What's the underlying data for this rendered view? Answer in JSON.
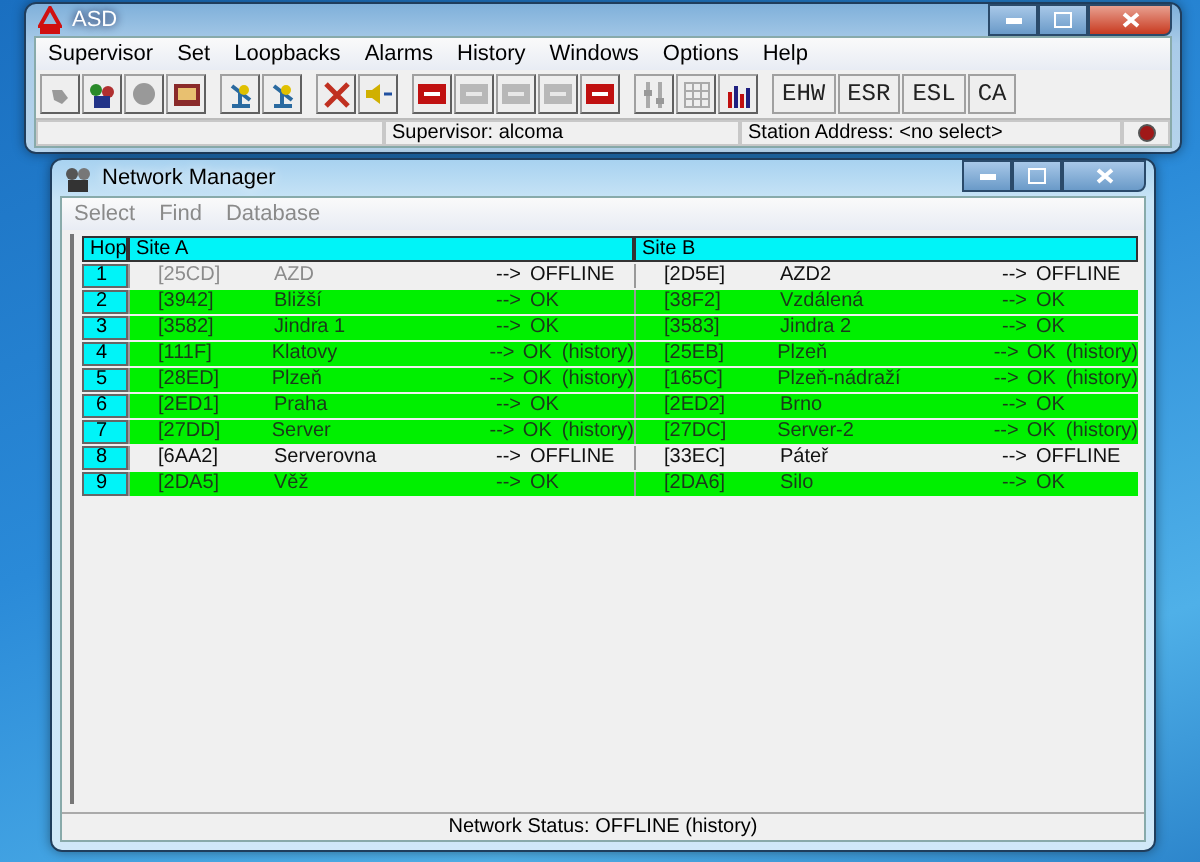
{
  "app_window": {
    "title": "ASD",
    "menu": [
      "Supervisor",
      "Set",
      "Loopbacks",
      "Alarms",
      "History",
      "Windows",
      "Options",
      "Help"
    ],
    "text_buttons": [
      "EHW",
      "ESR",
      "ESL",
      "CA"
    ],
    "status_bar": {
      "supervisor": "Supervisor: alcoma",
      "station_address": "Station Address: <no select>"
    }
  },
  "network_manager": {
    "title": "Network Manager",
    "menu": [
      {
        "label": "Select",
        "disabled": true
      },
      {
        "label": "Find",
        "disabled": true
      },
      {
        "label": "Database",
        "disabled": true
      }
    ],
    "columns": [
      "Hop",
      "Site A",
      "Site B"
    ],
    "rows": [
      {
        "hop": "1",
        "site_a": {
          "id": "[25CD]",
          "name": "AZD",
          "arrow": "-->",
          "status": "OFFLINE",
          "online": false,
          "faded": true
        },
        "site_b": {
          "id": "[2D5E]",
          "name": "AZD2",
          "arrow": "-->",
          "status": "OFFLINE",
          "online": false,
          "faded": false
        }
      },
      {
        "hop": "2",
        "site_a": {
          "id": "[3942]",
          "name": "Bližší",
          "arrow": "-->",
          "status": "OK",
          "online": true,
          "faded": false
        },
        "site_b": {
          "id": "[38F2]",
          "name": "Vzdálená",
          "arrow": "-->",
          "status": "OK",
          "online": true,
          "faded": false
        }
      },
      {
        "hop": "3",
        "site_a": {
          "id": "[3582]",
          "name": "Jindra 1",
          "arrow": "-->",
          "status": "OK",
          "online": true,
          "faded": false
        },
        "site_b": {
          "id": "[3583]",
          "name": "Jindra 2",
          "arrow": "-->",
          "status": "OK",
          "online": true,
          "faded": false
        }
      },
      {
        "hop": "4",
        "site_a": {
          "id": "[111F]",
          "name": "Klatovy",
          "arrow": "-->",
          "status": "OK",
          "note": "(history)",
          "online": true,
          "faded": false
        },
        "site_b": {
          "id": "[25EB]",
          "name": "Plzeň",
          "arrow": "-->",
          "status": "OK",
          "note": "(history)",
          "online": true,
          "faded": false
        }
      },
      {
        "hop": "5",
        "site_a": {
          "id": "[28ED]",
          "name": "Plzeň",
          "arrow": "-->",
          "status": "OK",
          "note": "(history)",
          "online": true,
          "faded": false
        },
        "site_b": {
          "id": "[165C]",
          "name": "Plzeň-nádraží",
          "arrow": "-->",
          "status": "OK",
          "note": "(history)",
          "online": true,
          "faded": false
        }
      },
      {
        "hop": "6",
        "site_a": {
          "id": "[2ED1]",
          "name": "Praha",
          "arrow": "-->",
          "status": "OK",
          "online": true,
          "faded": false
        },
        "site_b": {
          "id": "[2ED2]",
          "name": "Brno",
          "arrow": "-->",
          "status": "OK",
          "online": true,
          "faded": false
        }
      },
      {
        "hop": "7",
        "site_a": {
          "id": "[27DD]",
          "name": "Server",
          "arrow": "-->",
          "status": "OK",
          "note": "(history)",
          "online": true,
          "faded": false
        },
        "site_b": {
          "id": "[27DC]",
          "name": "Server-2",
          "arrow": "-->",
          "status": "OK",
          "note": "(history)",
          "online": true,
          "faded": false
        }
      },
      {
        "hop": "8",
        "site_a": {
          "id": "[6AA2]",
          "name": "Serverovna",
          "arrow": "-->",
          "status": "OFFLINE",
          "online": false,
          "faded": false
        },
        "site_b": {
          "id": "[33EC]",
          "name": "Páteř",
          "arrow": "-->",
          "status": "OFFLINE",
          "online": false,
          "faded": false
        }
      },
      {
        "hop": "9",
        "site_a": {
          "id": "[2DA5]",
          "name": "Věž",
          "arrow": "-->",
          "status": "OK",
          "online": true,
          "faded": false
        },
        "site_b": {
          "id": "[2DA6]",
          "name": "Silo",
          "arrow": "-->",
          "status": "OK",
          "online": true,
          "faded": false
        }
      }
    ],
    "status_bar": "Network Status: OFFLINE (history)"
  }
}
